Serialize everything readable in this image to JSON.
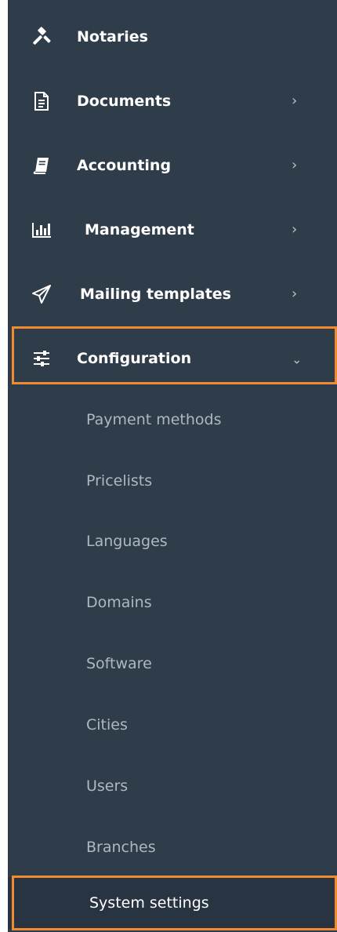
{
  "colors": {
    "sidebar_bg": "#2f3c4a",
    "active_bg": "#283441",
    "highlight": "#f28a30",
    "text_primary": "#ffffff",
    "text_secondary": "#aeb8c2"
  },
  "nav": {
    "items": [
      {
        "label": "Notaries",
        "icon": "gavel-icon",
        "has_children": false
      },
      {
        "label": "Documents",
        "icon": "document-icon",
        "has_children": true
      },
      {
        "label": "Accounting",
        "icon": "book-icon",
        "has_children": true
      },
      {
        "label": "Management",
        "icon": "bar-chart-icon",
        "has_children": true
      },
      {
        "label": "Mailing templates",
        "icon": "paper-plane-icon",
        "has_children": true
      },
      {
        "label": "Configuration",
        "icon": "sliders-icon",
        "has_children": true,
        "expanded": true
      }
    ],
    "chevron_right": "›",
    "chevron_down": "⌄"
  },
  "configuration": {
    "subitems": [
      {
        "label": "Payment methods"
      },
      {
        "label": "Pricelists"
      },
      {
        "label": "Languages"
      },
      {
        "label": "Domains"
      },
      {
        "label": "Software"
      },
      {
        "label": "Cities"
      },
      {
        "label": "Users"
      },
      {
        "label": "Branches"
      },
      {
        "label": "System settings",
        "active": true
      }
    ]
  }
}
